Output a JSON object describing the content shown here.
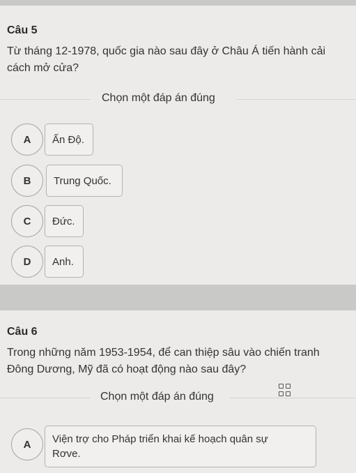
{
  "q5": {
    "title": "Câu 5",
    "text": "Từ tháng 12-1978, quốc gia nào sau đây ở Châu Á tiến hành cải cách mở cửa?",
    "instruction": "Chọn một đáp án đúng",
    "options": [
      {
        "letter": "A",
        "text": "Ấn Độ."
      },
      {
        "letter": "B",
        "text": "Trung Quốc."
      },
      {
        "letter": "C",
        "text": "Đức."
      },
      {
        "letter": "D",
        "text": "Anh."
      }
    ]
  },
  "q6": {
    "title": "Câu 6",
    "text": "Trong những năm 1953-1954, để can thiệp sâu vào chiến tranh Đông Dương, Mỹ đã có hoạt động nào sau đây?",
    "instruction": "Chọn một đáp án đúng",
    "options": [
      {
        "letter": "A",
        "text_line1": "Viện trợ cho Pháp triển khai kế hoạch quân sự",
        "text_line2": "Rơve."
      }
    ],
    "grid_icon": "grid-view-icon"
  }
}
